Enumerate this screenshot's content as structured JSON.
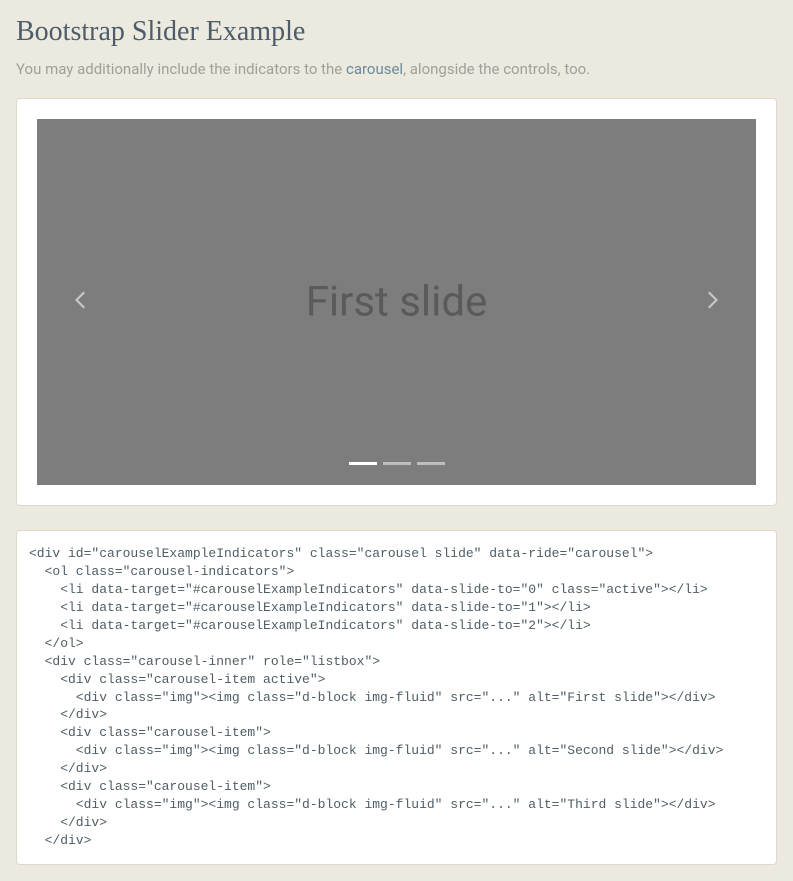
{
  "title": "Bootstrap Slider Example",
  "subtitle_prefix": "You may additionally include the indicators to the ",
  "subtitle_link": "carousel",
  "subtitle_suffix": ", alongside the controls, too.",
  "slide_label": "First slide",
  "code": "<div id=\"carouselExampleIndicators\" class=\"carousel slide\" data-ride=\"carousel\">\n  <ol class=\"carousel-indicators\">\n    <li data-target=\"#carouselExampleIndicators\" data-slide-to=\"0\" class=\"active\"></li>\n    <li data-target=\"#carouselExampleIndicators\" data-slide-to=\"1\"></li>\n    <li data-target=\"#carouselExampleIndicators\" data-slide-to=\"2\"></li>\n  </ol>\n  <div class=\"carousel-inner\" role=\"listbox\">\n    <div class=\"carousel-item active\">\n      <div class=\"img\"><img class=\"d-block img-fluid\" src=\"...\" alt=\"First slide\"></div>\n    </div>\n    <div class=\"carousel-item\">\n      <div class=\"img\"><img class=\"d-block img-fluid\" src=\"...\" alt=\"Second slide\"></div>\n    </div>\n    <div class=\"carousel-item\">\n      <div class=\"img\"><img class=\"d-block img-fluid\" src=\"...\" alt=\"Third slide\"></div>\n    </div>\n  </div>"
}
